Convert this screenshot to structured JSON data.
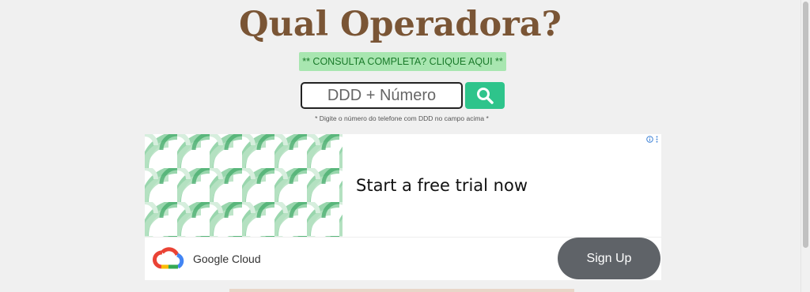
{
  "header": {
    "title": "Qual Operadora?"
  },
  "promo": {
    "label": "** CONSULTA COMPLETA? CLIQUE AQUI **"
  },
  "search": {
    "placeholder": "DDD + Número",
    "button_icon": "search-icon"
  },
  "hint": {
    "text": "* Digite o número do telefone com DDD no campo acima *"
  },
  "ad": {
    "headline": "Start a free trial now",
    "brand": "Google Cloud",
    "cta": "Sign Up",
    "cta_color": "#5f6368",
    "pattern_color": "#2e9e5a"
  },
  "colors": {
    "title": "#7a5535",
    "promo_bg": "#a8e6b0",
    "search_button": "#2ec48b",
    "background": "#f0f0f0"
  }
}
